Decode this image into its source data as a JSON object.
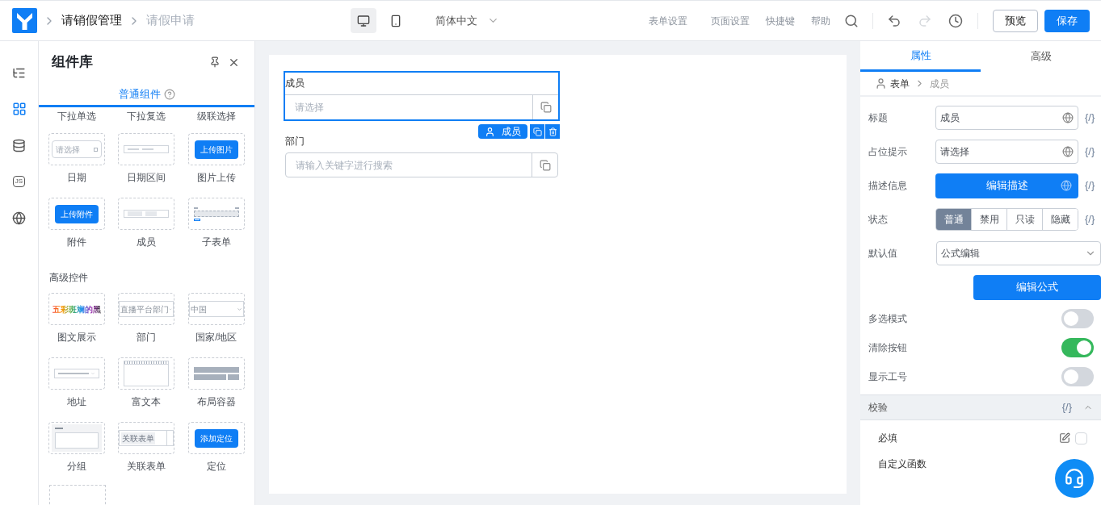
{
  "header": {
    "breadcrumb": [
      {
        "label": "请销假管理",
        "current": false
      },
      {
        "label": "请假申请",
        "current": true
      }
    ],
    "devices": [
      {
        "kind": "desktop",
        "selected": true
      },
      {
        "kind": "mobile",
        "selected": false
      }
    ],
    "language": "简体中文",
    "menu": [
      "表单设置",
      "页面设置",
      "快捷键",
      "帮助"
    ],
    "undo_enabled": true,
    "redo_enabled": false,
    "buttons": [
      {
        "label": "预览",
        "kind": "secondary"
      },
      {
        "label": "保存",
        "kind": "primary"
      }
    ]
  },
  "rail": [
    {
      "kind": "outline",
      "selected": false
    },
    {
      "kind": "components",
      "selected": true
    },
    {
      "kind": "data",
      "selected": false
    },
    {
      "kind": "js",
      "text": "JS",
      "selected": false
    },
    {
      "kind": "globe",
      "selected": false
    }
  ],
  "library": {
    "title": "组件库",
    "tabs": [
      {
        "label": "普通组件",
        "selected": true
      }
    ],
    "top_row": [
      "下拉单选",
      "下拉复选",
      "级联选择"
    ],
    "basic": [
      {
        "preview": {
          "kind": "date",
          "text": "请选择"
        },
        "label": "日期"
      },
      {
        "preview": {
          "kind": "range"
        },
        "label": "日期区间"
      },
      {
        "preview": {
          "kind": "button",
          "text": "上传图片"
        },
        "label": "图片上传"
      },
      {
        "preview": {
          "kind": "button",
          "text": "上传附件"
        },
        "label": "附件"
      },
      {
        "preview": {
          "kind": "tags"
        },
        "label": "成员"
      },
      {
        "preview": {
          "kind": "subform"
        },
        "label": "子表单"
      }
    ],
    "advanced_title": "高级控件",
    "advanced_rows": [
      [
        {
          "preview": {
            "kind": "rainbow",
            "text": "五彩斑斓的黑"
          },
          "label": "图文展示"
        },
        {
          "preview": {
            "kind": "select",
            "text": "直播平台部门"
          },
          "label": "部门"
        },
        {
          "preview": {
            "kind": "select",
            "text": "中国"
          },
          "label": "国家/地区"
        }
      ],
      [
        {
          "preview": {
            "kind": "address"
          },
          "label": "地址"
        },
        {
          "preview": {
            "kind": "richtext"
          },
          "label": "富文本"
        },
        {
          "preview": {
            "kind": "layout"
          },
          "label": "布局容器"
        }
      ],
      [
        {
          "preview": {
            "kind": "group"
          },
          "label": "分组"
        },
        {
          "preview": {
            "kind": "tagselect",
            "text": "关联表单"
          },
          "label": "关联表单"
        },
        {
          "preview": {
            "kind": "button",
            "text": "添加定位"
          },
          "label": "定位"
        }
      ]
    ]
  },
  "canvas": {
    "fields": [
      {
        "label": "成员",
        "placeholder": "请选择",
        "selected": true,
        "badge": "成员"
      },
      {
        "label": "部门",
        "placeholder": "请输入关键字进行搜索",
        "selected": false
      }
    ]
  },
  "properties": {
    "tabs": [
      {
        "label": "属性",
        "selected": true
      },
      {
        "label": "高级",
        "selected": false
      }
    ],
    "path": [
      "表单",
      "成员"
    ],
    "rows": [
      {
        "kind": "input",
        "label": "标题",
        "value": "成员",
        "expression": "{/}"
      },
      {
        "kind": "input",
        "label": "占位提示",
        "value": "请选择",
        "expression": "{/}"
      },
      {
        "kind": "button",
        "label": "描述信息",
        "value": "编辑描述",
        "expression": "{/}"
      },
      {
        "kind": "segmented",
        "label": "状态",
        "options": [
          {
            "label": "普通",
            "selected": true
          },
          {
            "label": "禁用",
            "selected": false
          },
          {
            "label": "只读",
            "selected": false
          },
          {
            "label": "隐藏",
            "selected": false
          }
        ],
        "expression": "{/}"
      },
      {
        "kind": "select",
        "label": "默认值",
        "value": "公式编辑"
      },
      {
        "kind": "button",
        "value": "编辑公式"
      },
      {
        "kind": "toggle",
        "label": "多选模式",
        "on": false
      },
      {
        "kind": "toggle",
        "label": "清除按钮",
        "on": true
      },
      {
        "kind": "toggle",
        "label": "显示工号",
        "on": false
      }
    ],
    "section": {
      "title": "校验",
      "expression": "{/}",
      "expanded": true,
      "items": [
        {
          "label": "必填",
          "checked": false
        },
        {
          "label": "自定义函数"
        }
      ]
    }
  }
}
